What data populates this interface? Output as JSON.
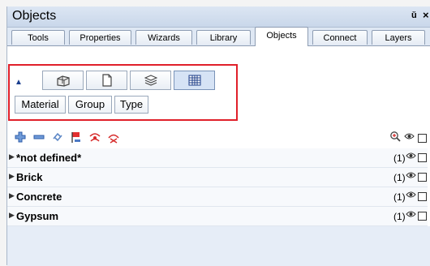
{
  "window": {
    "title": "Objects",
    "pin_icon": "pin-icon",
    "close_icon": "close-icon"
  },
  "tabs": [
    {
      "label": "Tools"
    },
    {
      "label": "Properties"
    },
    {
      "label": "Wizards"
    },
    {
      "label": "Library"
    },
    {
      "label": "Objects",
      "active": true
    },
    {
      "label": "Connect"
    },
    {
      "label": "Layers"
    }
  ],
  "view_bar": {
    "collapse_icon": "triangle-up-icon",
    "buttons": [
      {
        "icon": "building-icon"
      },
      {
        "icon": "document-icon"
      },
      {
        "icon": "layers-icon"
      },
      {
        "icon": "grid-icon",
        "active": true
      }
    ],
    "group_by": [
      {
        "label": "Material"
      },
      {
        "label": "Group"
      },
      {
        "label": "Type"
      }
    ]
  },
  "toolbar": {
    "icons": [
      "add-icon",
      "remove-icon",
      "transfer-icon",
      "flag-icon",
      "eye-refresh-icon",
      "delete-icon"
    ],
    "right_icons": [
      "zoom-icon",
      "eye-icon",
      "checkbox"
    ]
  },
  "rows": [
    {
      "label": "*not defined*",
      "count": "(1)"
    },
    {
      "label": "Brick",
      "count": "(1)"
    },
    {
      "label": "Concrete",
      "count": "(1)"
    },
    {
      "label": "Gypsum",
      "count": "(1)"
    }
  ],
  "colors": {
    "highlight_border": "#e0202a",
    "panel_bg": "#dfe8f4"
  }
}
